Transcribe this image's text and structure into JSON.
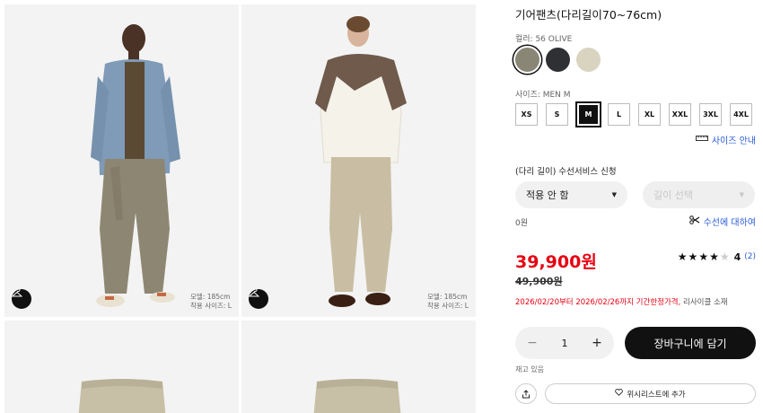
{
  "product": {
    "title": "기어팬츠(다리길이70~76cm)"
  },
  "gallery": {
    "photos": [
      {
        "model_height": "모델: 185cm",
        "model_size": "착용 사이즈: L",
        "hanger_icon": "hanger-icon"
      },
      {
        "model_height": "모델: 185cm",
        "model_size": "착용 사이즈: L",
        "hanger_icon": "hanger-icon"
      }
    ]
  },
  "color": {
    "label": "컬러: 56 OLIVE",
    "swatches": [
      {
        "name": "olive",
        "hex": "#8a8676",
        "selected": true
      },
      {
        "name": "black",
        "hex": "#2e3034",
        "selected": false
      },
      {
        "name": "beige",
        "hex": "#d9d4c0",
        "selected": false
      }
    ]
  },
  "size": {
    "label": "사이즈: MEN M",
    "options": [
      "XS",
      "S",
      "M",
      "L",
      "XL",
      "XXL",
      "3XL",
      "4XL"
    ],
    "selected": "M",
    "guide_label": "사이즈 안내",
    "guide_icon": "ruler-icon"
  },
  "alteration": {
    "title": "(다리 길이) 수선서비스 신청",
    "option_value": "적용 안 함",
    "length_placeholder": "길이 선택",
    "fee": "0원",
    "info_label": "수선에 대하여",
    "info_icon": "scissors-icon"
  },
  "pricing": {
    "price": "39,900원",
    "original_price": "49,900원",
    "period_red": "2026/02/20부터 2026/02/26까지 기간한정가격,",
    "period_gray": " 리사이클 소재"
  },
  "rating": {
    "stars_filled": 4,
    "stars_total": 5,
    "value": "4",
    "count": "(2)"
  },
  "purchase": {
    "minus": "−",
    "quantity": "1",
    "plus": "+",
    "cart_label": "장바구니에 담기",
    "stock": "재고 있음",
    "wishlist_label": "위시리스트에 추가",
    "share_icon": "share-icon",
    "heart_icon": "heart-icon"
  },
  "colors": {
    "price_red": "#e60012",
    "link_blue": "#2a5bd7",
    "cart_black": "#111111"
  }
}
